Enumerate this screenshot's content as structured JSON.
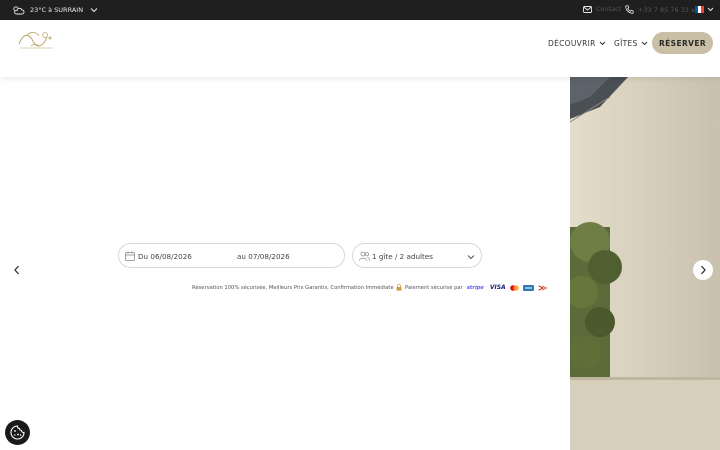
{
  "topbar": {
    "weather": "23°C à SURRAIN",
    "contact": "Contact",
    "phone": "+33 7 85 76 33 xx",
    "language_flag_colors": [
      "#0055a4",
      "#ffffff",
      "#ef4135"
    ]
  },
  "header": {
    "logo_text": "Domaine",
    "nav": [
      {
        "label": "DÉCOUVRIR"
      },
      {
        "label": "GÎTES"
      }
    ],
    "reserve_label": "RÉSERVER"
  },
  "booking": {
    "date_from": "Du 06/08/2026",
    "date_to": "au 07/08/2026",
    "guests": "1 gîte / 2 adultes"
  },
  "reassurance": {
    "text": "Réservation 100% sécurisée, Meilleurs Prix Garantis, Confirmation Immédiate",
    "secure_label": "Paiement sécurisé par",
    "stripe": "stripe",
    "visa": "VISA"
  },
  "colors": {
    "topbar_bg": "#1f1f1f",
    "reserve_bg": "#c9bfa6",
    "stripe": "#635bff",
    "visa": "#1a1f71"
  }
}
